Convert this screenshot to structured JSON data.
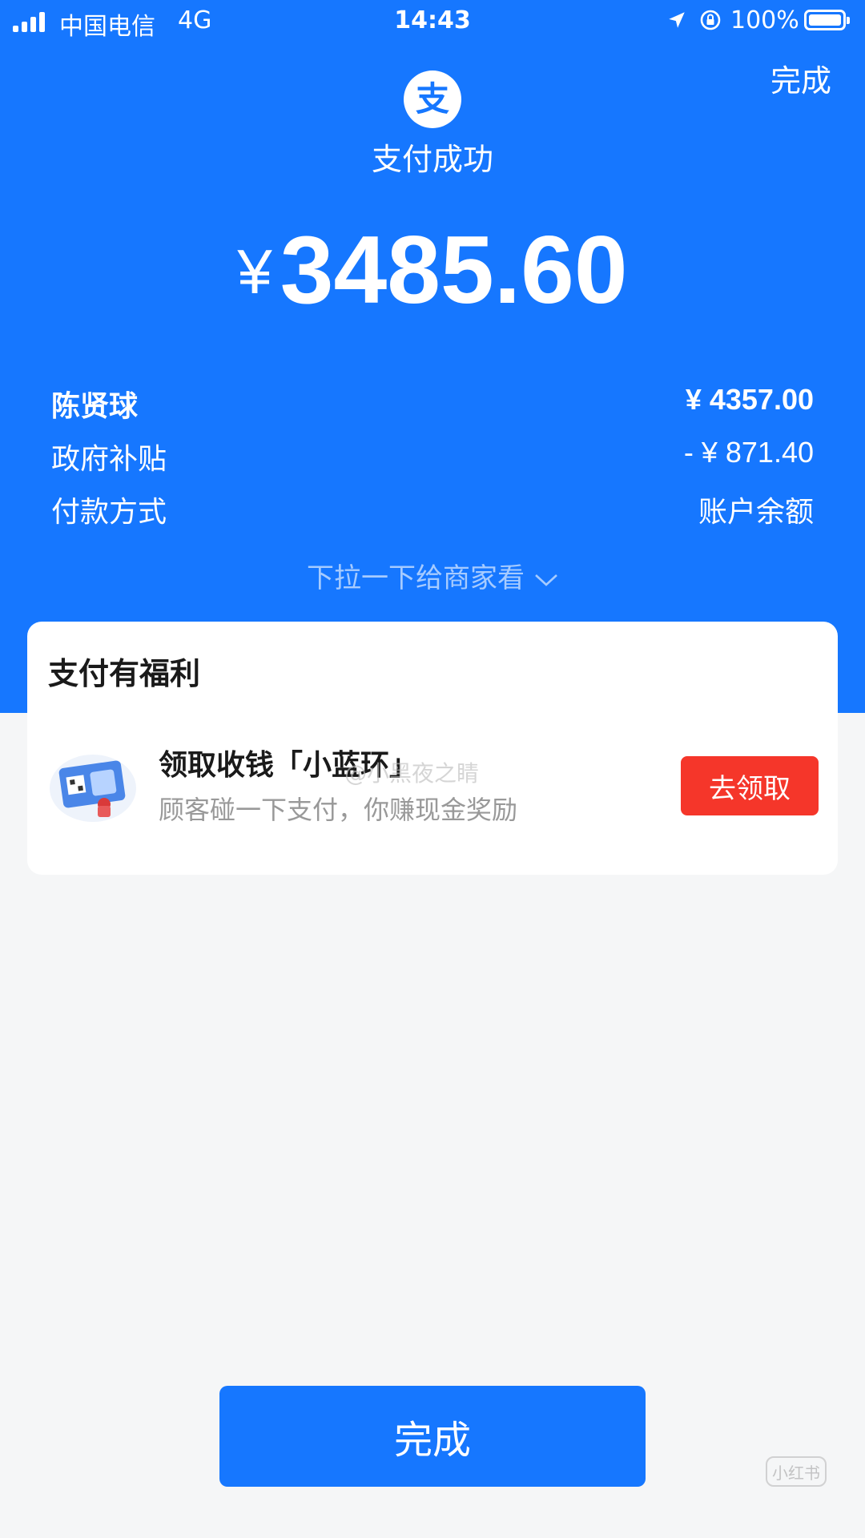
{
  "status_bar": {
    "carrier": "中国电信",
    "network": "4G",
    "time": "14:43",
    "battery": "100%"
  },
  "header": {
    "done_label": "完成",
    "logo_icon": "alipay-logo-icon",
    "title": "支付成功"
  },
  "payment": {
    "currency": "¥",
    "amount": "3485.60"
  },
  "details": [
    {
      "label": "陈贤球",
      "value": "¥ 4357.00"
    },
    {
      "label": "政府补贴",
      "value": "- ¥ 871.40"
    },
    {
      "label": "付款方式",
      "value": "账户余额"
    }
  ],
  "pull_hint": "下拉一下给商家看",
  "benefits": {
    "title": "支付有福利",
    "headline": "领取收钱「小蓝环」",
    "subtext": "顾客碰一下支付，你赚现金奖励",
    "button_label": "去领取"
  },
  "watermark": "@小黑夜之睛",
  "footer": {
    "done_label": "完成",
    "brand_mark": "小红书"
  },
  "colors": {
    "primary_blue": "#1677ff",
    "claim_red": "#f5362a",
    "page_bg": "#f5f6f7"
  }
}
